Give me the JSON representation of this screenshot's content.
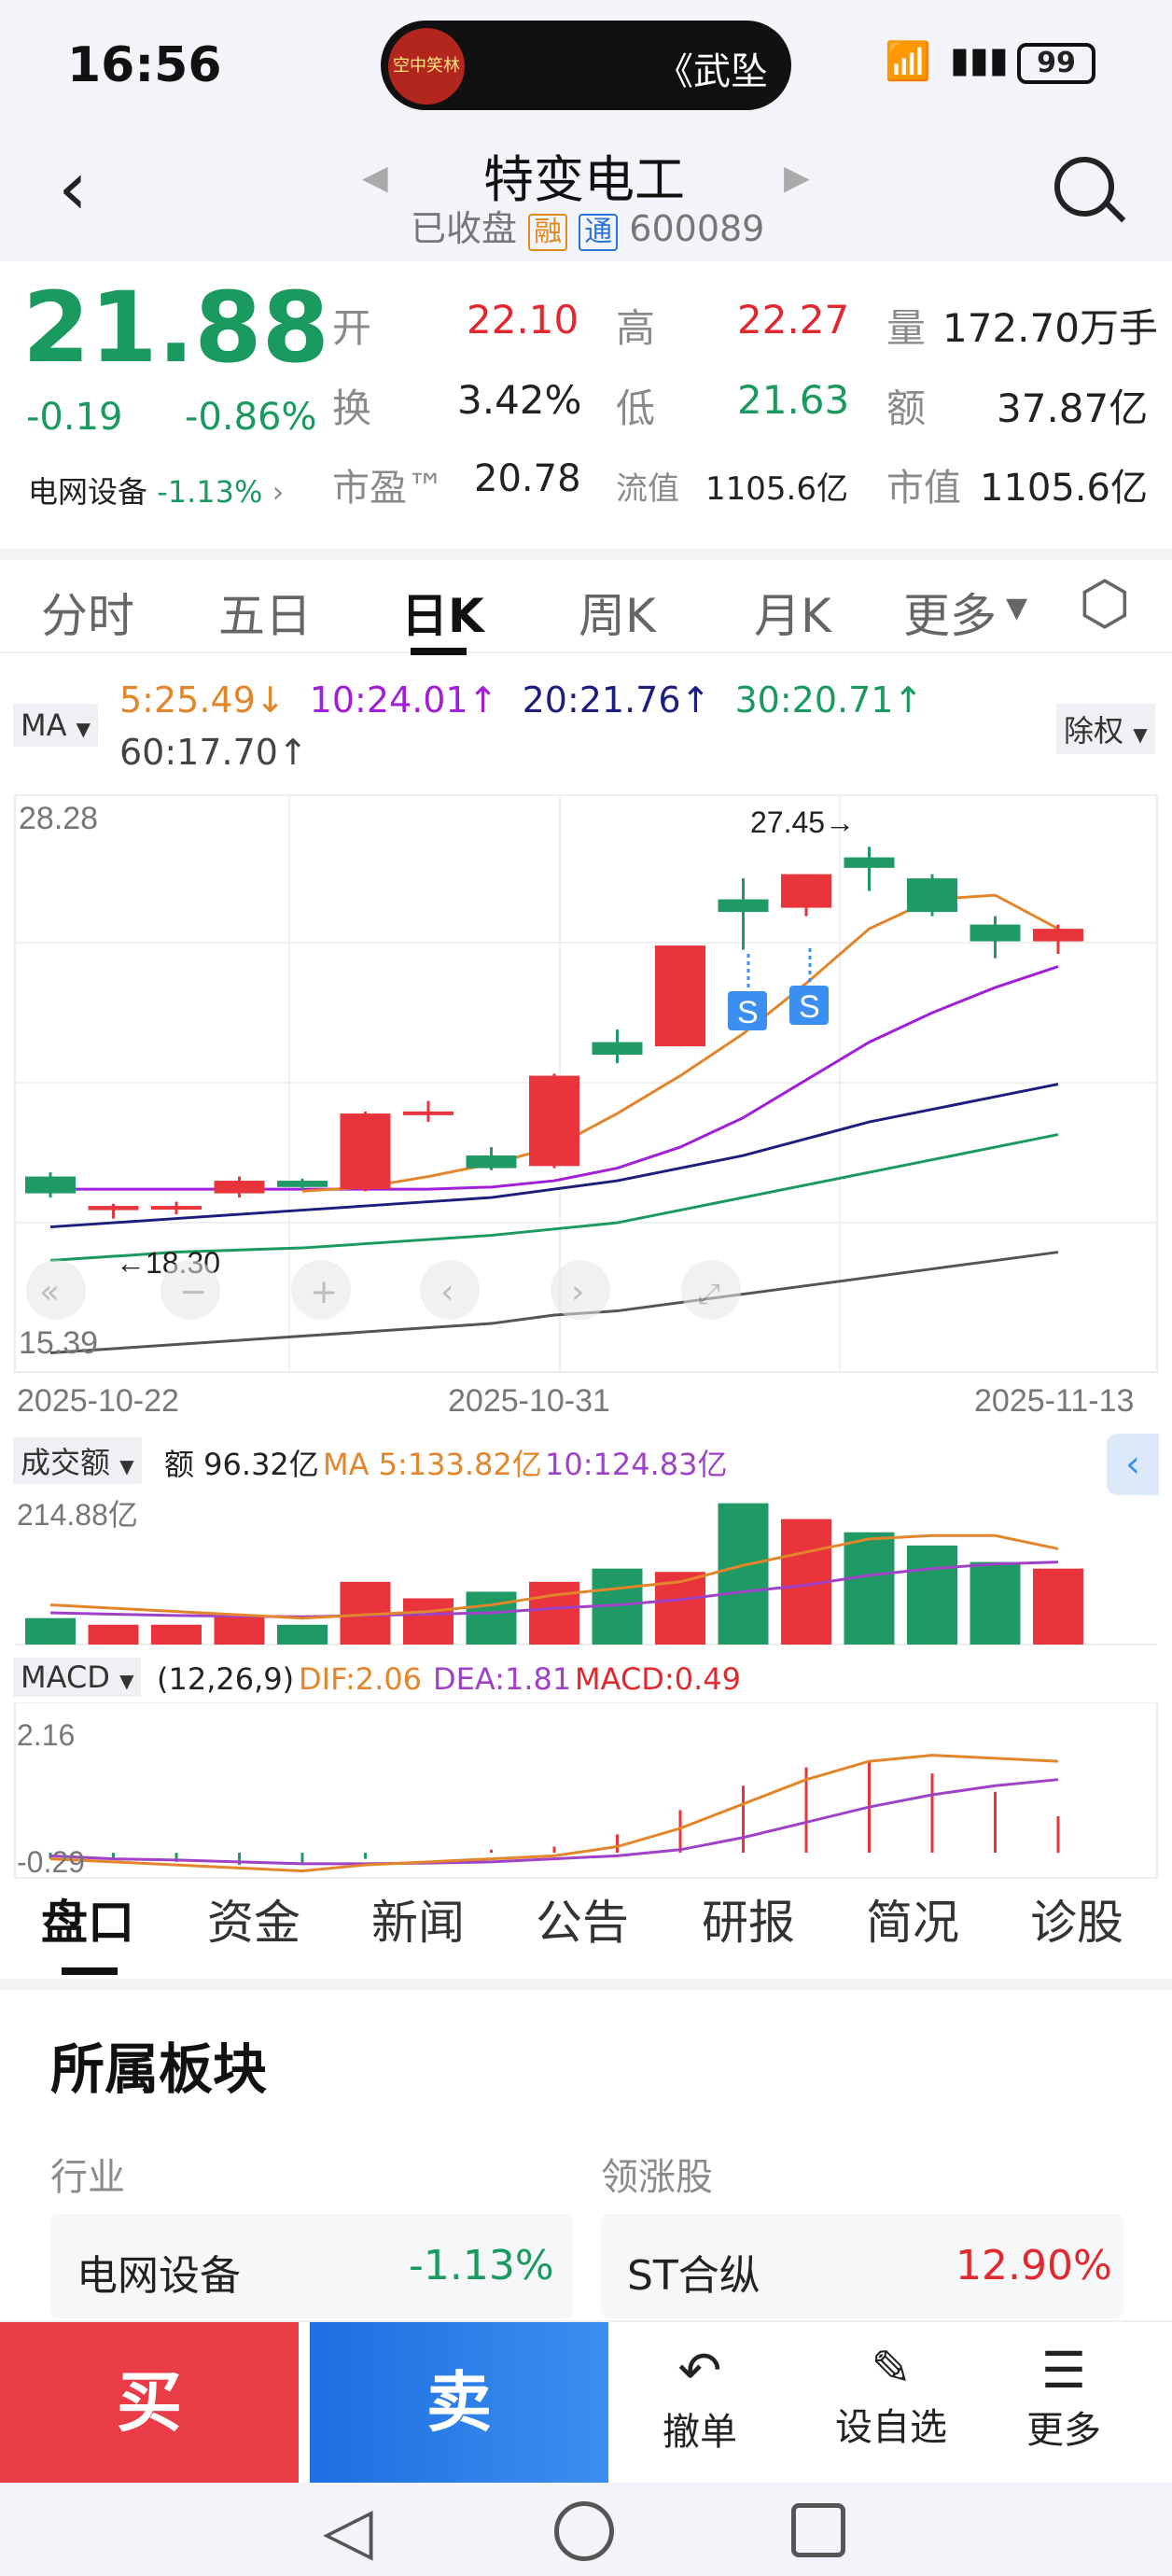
{
  "status": {
    "time": "16:56",
    "ticker_pill": "《武坠",
    "battery": "99",
    "avatar_text": "空中笑林"
  },
  "header": {
    "title": "特变电工",
    "status": "已收盘",
    "badge_rong": "融",
    "badge_tong": "通",
    "code": "600089"
  },
  "quote": {
    "price": "21.88",
    "change": "-0.19",
    "change_pct": "-0.86%",
    "sector_name": "电网设备",
    "sector_pct": "-1.13%",
    "open_label": "开",
    "open": "22.10",
    "high_label": "高",
    "high": "22.27",
    "vol_label": "量",
    "vol": "172.70万手",
    "turn_label": "换",
    "turn": "3.42%",
    "low_label": "低",
    "low": "21.63",
    "amt_label": "额",
    "amt": "37.87亿",
    "pe_label": "市盈™",
    "pe": "20.78",
    "float_label": "流值",
    "float": "1105.6亿",
    "mcap_label": "市值",
    "mcap": "1105.6亿"
  },
  "tabs": [
    "分时",
    "五日",
    "日K",
    "周K",
    "月K",
    "更多"
  ],
  "ma": {
    "button": "MA",
    "ma5": "5:25.49↓",
    "ma10": "10:24.01↑",
    "ma20": "20:21.76↑",
    "ma30": "30:20.71↑",
    "ma60": "60:17.70↑",
    "right_button": "除权"
  },
  "kchart": {
    "ymax_label": "28.28",
    "ymin_label": "15.39",
    "peak_label": "27.45→",
    "low_label": "←18.30",
    "dates": [
      "2025-10-22",
      "2025-10-31",
      "2025-11-13"
    ]
  },
  "volume": {
    "button": "成交额",
    "amt": "额 96.32亿",
    "ma5": "MA 5:133.82亿",
    "ma10": "10:124.83亿",
    "ymax": "214.88亿"
  },
  "macd": {
    "button": "MACD",
    "params": "(12,26,9)",
    "dif": "DIF:2.06",
    "dea": "DEA:1.81",
    "macd": "MACD:0.49",
    "ymax": "2.16",
    "ymin": "-0.29"
  },
  "bottom_tabs": [
    "盘口",
    "资金",
    "新闻",
    "公告",
    "研报",
    "简况",
    "诊股"
  ],
  "section": {
    "title": "所属板块",
    "industry_label": "行业",
    "leader_label": "领涨股",
    "industry_name": "电网设备",
    "industry_pct": "-1.13%",
    "leader_name": "ST合纵",
    "leader_pct": "12.90%"
  },
  "actions": {
    "buy": "买",
    "sell": "卖",
    "cancel": "撤单",
    "watch": "设自选",
    "more": "更多"
  },
  "chart_data": {
    "type": "candlestick",
    "candles": [
      {
        "o": 19.6,
        "c": 19.2,
        "h": 19.7,
        "l": 19.1
      },
      {
        "o": 18.9,
        "c": 18.8,
        "h": 18.95,
        "l": 18.6
      },
      {
        "o": 18.9,
        "c": 18.9,
        "h": 19.0,
        "l": 18.7
      },
      {
        "o": 19.2,
        "c": 19.5,
        "h": 19.6,
        "l": 19.1
      },
      {
        "o": 19.5,
        "c": 19.35,
        "h": 19.55,
        "l": 19.3
      },
      {
        "o": 19.3,
        "c": 21.1,
        "h": 21.15,
        "l": 19.25
      },
      {
        "o": 21.1,
        "c": 21.15,
        "h": 21.4,
        "l": 20.9
      },
      {
        "o": 19.8,
        "c": 20.1,
        "h": 20.3,
        "l": 19.75
      },
      {
        "o": 19.85,
        "c": 22.0,
        "h": 22.05,
        "l": 19.8
      },
      {
        "o": 22.8,
        "c": 22.5,
        "h": 23.1,
        "l": 22.3
      },
      {
        "o": 22.7,
        "c": 25.1,
        "h": 25.1,
        "l": 22.7
      },
      {
        "o": 26.2,
        "c": 25.9,
        "h": 26.7,
        "l": 25.0
      },
      {
        "o": 26.0,
        "c": 26.8,
        "h": 26.8,
        "l": 25.8
      },
      {
        "o": 27.2,
        "c": 26.95,
        "h": 27.45,
        "l": 26.4
      },
      {
        "o": 26.7,
        "c": 25.9,
        "h": 26.8,
        "l": 25.8
      },
      {
        "o": 25.6,
        "c": 25.2,
        "h": 25.8,
        "l": 24.8
      },
      {
        "o": 25.5,
        "c": 25.2,
        "h": 25.6,
        "l": 24.9
      }
    ],
    "bar_colors": [
      "g",
      "r",
      "r",
      "r",
      "g",
      "r",
      "r",
      "g",
      "r",
      "g",
      "r",
      "g",
      "r",
      "g",
      "g",
      "g",
      "r"
    ],
    "ma5": [
      null,
      null,
      null,
      null,
      19.25,
      19.35,
      19.6,
      19.9,
      20.3,
      21.1,
      22.0,
      23.0,
      24.2,
      25.5,
      26.2,
      26.3,
      25.5
    ],
    "ma10": [
      19.3,
      19.3,
      19.3,
      19.3,
      19.3,
      19.3,
      19.3,
      19.35,
      19.5,
      19.8,
      20.3,
      21.0,
      21.9,
      22.8,
      23.5,
      24.1,
      24.6
    ],
    "ma20": [
      18.4,
      18.5,
      18.6,
      18.7,
      18.8,
      18.9,
      19.0,
      19.1,
      19.3,
      19.5,
      19.8,
      20.1,
      20.5,
      20.9,
      21.2,
      21.5,
      21.8
    ],
    "ma30": [
      17.6,
      17.7,
      17.8,
      17.85,
      17.9,
      18.0,
      18.1,
      18.2,
      18.35,
      18.5,
      18.8,
      19.1,
      19.4,
      19.7,
      20.0,
      20.3,
      20.6
    ],
    "ma60": [
      15.4,
      15.5,
      15.6,
      15.7,
      15.8,
      15.9,
      16.0,
      16.1,
      16.3,
      16.4,
      16.6,
      16.8,
      17.0,
      17.2,
      17.4,
      17.6,
      17.8
    ],
    "volumes": [
      40,
      30,
      30,
      45,
      30,
      95,
      70,
      80,
      95,
      115,
      110,
      214,
      190,
      170,
      150,
      125,
      115
    ],
    "vol_ma5": [
      60,
      55,
      50,
      45,
      40,
      45,
      50,
      60,
      75,
      85,
      95,
      120,
      140,
      160,
      165,
      165,
      145
    ],
    "vol_ma10": [
      48,
      46,
      44,
      43,
      42,
      44,
      46,
      48,
      55,
      60,
      68,
      80,
      90,
      105,
      115,
      122,
      125
    ],
    "dif": [
      -0.1,
      -0.15,
      -0.2,
      -0.25,
      -0.3,
      -0.2,
      -0.15,
      -0.1,
      -0.05,
      0.1,
      0.4,
      0.8,
      1.2,
      1.5,
      1.6,
      1.55,
      1.5
    ],
    "dea": [
      -0.05,
      -0.1,
      -0.12,
      -0.15,
      -0.18,
      -0.18,
      -0.17,
      -0.15,
      -0.1,
      -0.05,
      0.05,
      0.25,
      0.5,
      0.75,
      0.95,
      1.1,
      1.2
    ],
    "macd_hist": [
      -0.1,
      -0.1,
      -0.15,
      -0.2,
      -0.2,
      -0.1,
      0,
      0.05,
      0.1,
      0.3,
      0.7,
      1.1,
      1.4,
      1.5,
      1.3,
      1.0,
      0.6
    ]
  }
}
